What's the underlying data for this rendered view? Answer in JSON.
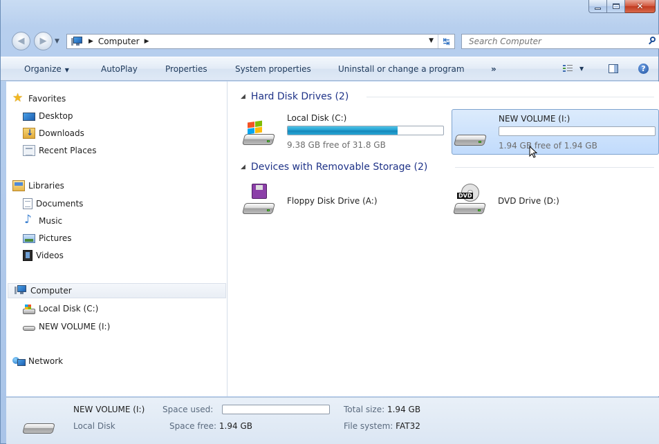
{
  "window": {
    "caption_buttons": {
      "minimize": "–",
      "maximize": "□",
      "close": "✕"
    }
  },
  "address": {
    "crumbs": [
      "Computer"
    ],
    "search_placeholder": "Search Computer"
  },
  "toolbar": {
    "organize": "Organize",
    "autoplay": "AutoPlay",
    "properties": "Properties",
    "system_properties": "System properties",
    "uninstall": "Uninstall or change a program",
    "more": "»"
  },
  "nav": {
    "favorites": "Favorites",
    "desktop": "Desktop",
    "downloads": "Downloads",
    "recent_places": "Recent Places",
    "libraries": "Libraries",
    "documents": "Documents",
    "music": "Music",
    "pictures": "Pictures",
    "videos": "Videos",
    "computer": "Computer",
    "local_disk": "Local Disk (C:)",
    "new_volume": "NEW VOLUME (I:)",
    "network": "Network"
  },
  "content": {
    "hdd_header": "Hard Disk Drives (2)",
    "removable_header": "Devices with Removable Storage (2)",
    "drives": [
      {
        "name": "Local Disk (C:)",
        "free_text": "9.38 GB free of 31.8 GB",
        "used_fraction": 0.705,
        "icon": "windows-drive-icon"
      },
      {
        "name": "NEW VOLUME (I:)",
        "free_text": "1.94 GB free of 1.94 GB",
        "used_fraction": 0.0,
        "icon": "hard-drive-icon",
        "selected": true
      }
    ],
    "removable": [
      {
        "name": "Floppy Disk Drive (A:)",
        "icon": "floppy-drive-icon"
      },
      {
        "name": "DVD Drive (D:)",
        "icon": "dvd-drive-icon",
        "badge": "DVD"
      }
    ]
  },
  "details": {
    "name": "NEW VOLUME (I:)",
    "type": "Local Disk",
    "space_used_label": "Space used:",
    "space_free_label": "Space free:",
    "space_free_value": "1.94 GB",
    "total_size_label": "Total size:",
    "total_size_value": "1.94 GB",
    "file_system_label": "File system:",
    "file_system_value": "FAT32"
  },
  "colors": {
    "group_header": "#1e3287",
    "selection": "#c1dbfc",
    "bar_fill": "#1e9ccf"
  }
}
